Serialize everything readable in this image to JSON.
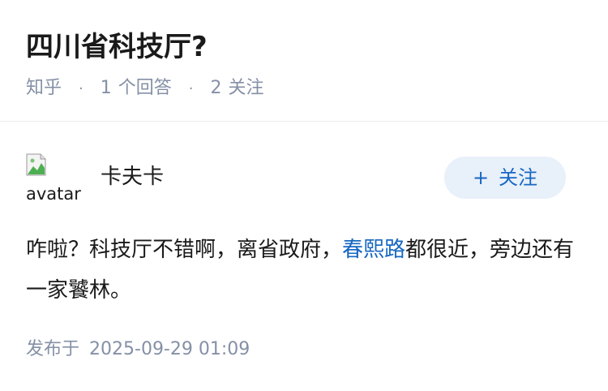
{
  "question": {
    "title": "四川省科技厅?",
    "source": "知乎",
    "separator": "·",
    "answers_count": "1",
    "answers_label": "个回答",
    "followers_count": "2",
    "followers_label": "关注"
  },
  "answer": {
    "author": {
      "name": "卡夫卡",
      "avatar_alt": "avatar"
    },
    "follow_button": {
      "icon": "+",
      "label": "关注"
    },
    "content": {
      "text_before": "咋啦？科技厅不错啊，离省政府，",
      "link_text": "春熙路",
      "text_after": "都很近，旁边还有一家饕林。"
    },
    "publish_label": "发布于",
    "publish_time": "2025-09-29 01:09"
  },
  "colors": {
    "accent": "#1767c2",
    "meta_gray": "#8590a6",
    "button_bg": "#e8f0fa",
    "text": "#1a1a1a"
  }
}
